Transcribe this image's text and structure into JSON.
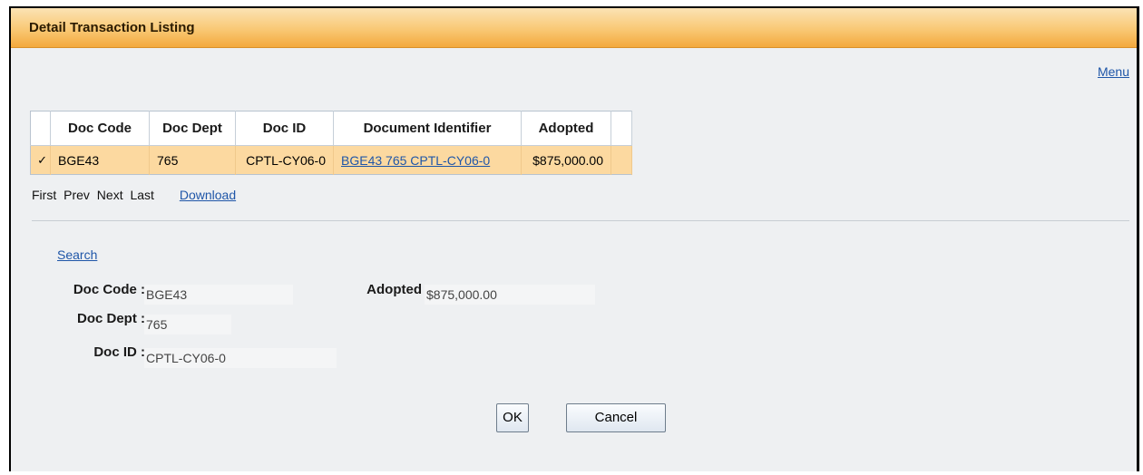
{
  "window": {
    "title": "Detail Transaction Listing",
    "menu_link": "Menu"
  },
  "grid": {
    "columns": [
      "Doc Code",
      "Doc Dept",
      "Doc ID",
      "Document Identifier",
      "Adopted"
    ],
    "rows": [
      {
        "check": "✓",
        "doc_code": "BGE43",
        "doc_dept": "765",
        "doc_id": "CPTL-CY06-0",
        "document_identifier": "BGE43 765 CPTL-CY06-0",
        "adopted": "$875,000.00"
      }
    ]
  },
  "pager": {
    "first": "First",
    "prev": "Prev",
    "next": "Next",
    "last": "Last",
    "download": "Download"
  },
  "search_link": "Search",
  "form": {
    "doc_code": {
      "label": "Doc Code :",
      "value": "BGE43"
    },
    "doc_dept": {
      "label": "Doc Dept :",
      "value": "765"
    },
    "doc_id": {
      "label": "Doc ID :",
      "value": "CPTL-CY06-0"
    },
    "adopted": {
      "label": "Adopted",
      "value": "$875,000.00"
    }
  },
  "buttons": {
    "ok": "OK",
    "cancel": "Cancel"
  }
}
